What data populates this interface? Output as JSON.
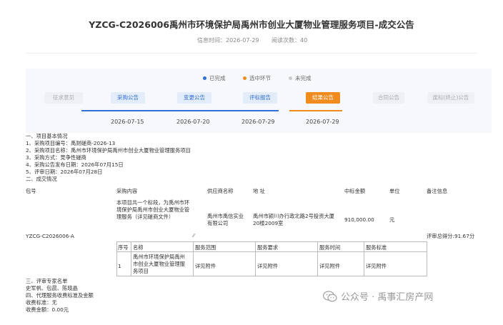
{
  "header": {
    "title": "YZCG-C2026006禹州市环境保护局禹州市创业大厦物业管理服务项目-成交公告",
    "publish_label": "信息时间：",
    "publish_date": "2026-07-29",
    "views_label": "阅读次数：",
    "views": "40"
  },
  "legend": {
    "done": "已完成",
    "current": "选中环节",
    "pending": "未完成",
    "colors": {
      "done": "#2f6fd6",
      "current": "#f08c1e",
      "pending": "#cccccc"
    }
  },
  "steps": [
    {
      "label": "征求意见",
      "state": "inactive"
    },
    {
      "label": "采购公告",
      "state": "done",
      "date": "2026-07-15"
    },
    {
      "label": "变更公告",
      "state": "done",
      "date": "2026-07-20"
    },
    {
      "label": "评标报告",
      "state": "done",
      "date": "2026-07-29"
    },
    {
      "label": "结果公告",
      "state": "current",
      "date": "2026-07-29"
    },
    {
      "label": "合同公告",
      "state": "inactive"
    },
    {
      "label": "废标(终止)公告",
      "state": "inactive"
    }
  ],
  "body": {
    "s1": "一、项目基本情况",
    "l1": "1、采购项目编号：禹财磋商-2026-13",
    "l2": "2、采购项目名称：禹州市环境保护局禹州市创业大厦物业管理服务项目",
    "l3": "3、采购方式：竞争性磋商",
    "l4": "4、采购公告发布日期：2026年07月15日",
    "l5": "5、评审日期：2026年07月28日",
    "s2": "二、成交情况"
  },
  "result_table": {
    "headers": {
      "package": "包号",
      "content": "采购内容",
      "supplier": "供应商名称",
      "address": "地 址",
      "amount": "中标金额",
      "unit": "单位",
      "remark": "备注信息"
    },
    "content_lines": [
      "本项目共一个标段，为禹州市环",
      "境保护局禹州市创业大厦物业管",
      "理服务（详见磋商文件）"
    ],
    "supplier_lines": [
      "禹州市禹信实业",
      "有限公司"
    ],
    "address_lines": [
      "禹州市颍川办行政北路2号投资大厦",
      "20楼2009室"
    ],
    "amount": "910,000.00",
    "unit": "元",
    "package": "YZCG-C2026006-A",
    "score": "评审总得分:91.67分"
  },
  "sub_table": {
    "headers": [
      "序号",
      "名称",
      "服务范围",
      "服务要求",
      "服务时间",
      "服务标准"
    ],
    "row": {
      "index": "1",
      "name_lines": [
        "禹州市环境保护局禹州",
        "市创业大厦物业管理服",
        "务项目"
      ],
      "scope": "详见附件",
      "requirement": "详见附件",
      "time": "详见附件",
      "standard": "详见附件"
    }
  },
  "footer": {
    "s3": "三、评审专家名单",
    "experts": "史军帆、包晨、陈晓晶",
    "s4": "四、代理服务收费标准及金额",
    "fee_standard": "收费标准：无",
    "fee_amount": "收费金额：0.00元"
  },
  "watermark": {
    "account": "公众号 · 禹事汇房产网"
  }
}
